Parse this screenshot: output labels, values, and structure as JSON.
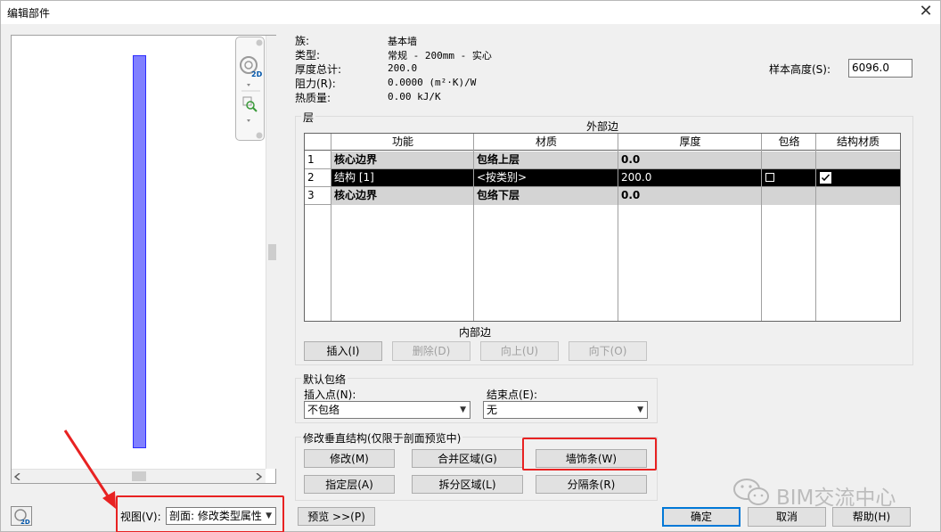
{
  "window": {
    "title": "编辑部件",
    "close_glyph": "✕"
  },
  "props": [
    {
      "label": "族:",
      "value": "基本墙"
    },
    {
      "label": "类型:",
      "value": "常规 - 200mm - 实心"
    },
    {
      "label": "厚度总计:",
      "value": "200.0"
    },
    {
      "label": "阻力(R):",
      "value": "0.0000 (m²·K)/W"
    },
    {
      "label": "热质量:",
      "value": "0.00 kJ/K"
    }
  ],
  "sample_height": {
    "label": "样本高度(S):",
    "value": "6096.0"
  },
  "layers": {
    "group_title": "层",
    "exterior_label": "外部边",
    "interior_label": "内部边",
    "columns": [
      "功能",
      "材质",
      "厚度",
      "包络",
      "结构材质"
    ],
    "rows": [
      {
        "num": "1",
        "func": "核心边界",
        "material": "包络上层",
        "thickness": "0.0",
        "wrap": false,
        "struct": false,
        "type": "boundary"
      },
      {
        "num": "2",
        "func": "结构 [1]",
        "material": "<按类别>",
        "thickness": "200.0",
        "wrap": false,
        "struct": true,
        "type": "selected"
      },
      {
        "num": "3",
        "func": "核心边界",
        "material": "包络下层",
        "thickness": "0.0",
        "wrap": false,
        "struct": false,
        "type": "boundary"
      }
    ],
    "buttons": {
      "insert": "插入(I)",
      "delete": "删除(D)",
      "up": "向上(U)",
      "down": "向下(O)"
    }
  },
  "default_wrap": {
    "title": "默认包络",
    "insert_label": "插入点(N):",
    "insert_value": "不包络",
    "end_label": "结束点(E):",
    "end_value": "无"
  },
  "vertical": {
    "title": "修改垂直结构(仅限于剖面预览中)",
    "modify": "修改(M)",
    "merge": "合并区域(G)",
    "sweep": "墙饰条(W)",
    "assign": "指定层(A)",
    "split": "拆分区域(L)",
    "reveal": "分隔条(R)"
  },
  "view": {
    "label": "视图(V):",
    "value": "剖面: 修改类型属性"
  },
  "buttons": {
    "preview": "预览 >>(P)",
    "ok": "确定",
    "cancel": "取消",
    "help": "帮助(H)"
  },
  "watermark": "BIM交流中心",
  "colors": {
    "wall_preview": "#8080ff",
    "highlight_red": "#e82222",
    "selected_row": "#000000",
    "primary_border": "#0078d7"
  }
}
